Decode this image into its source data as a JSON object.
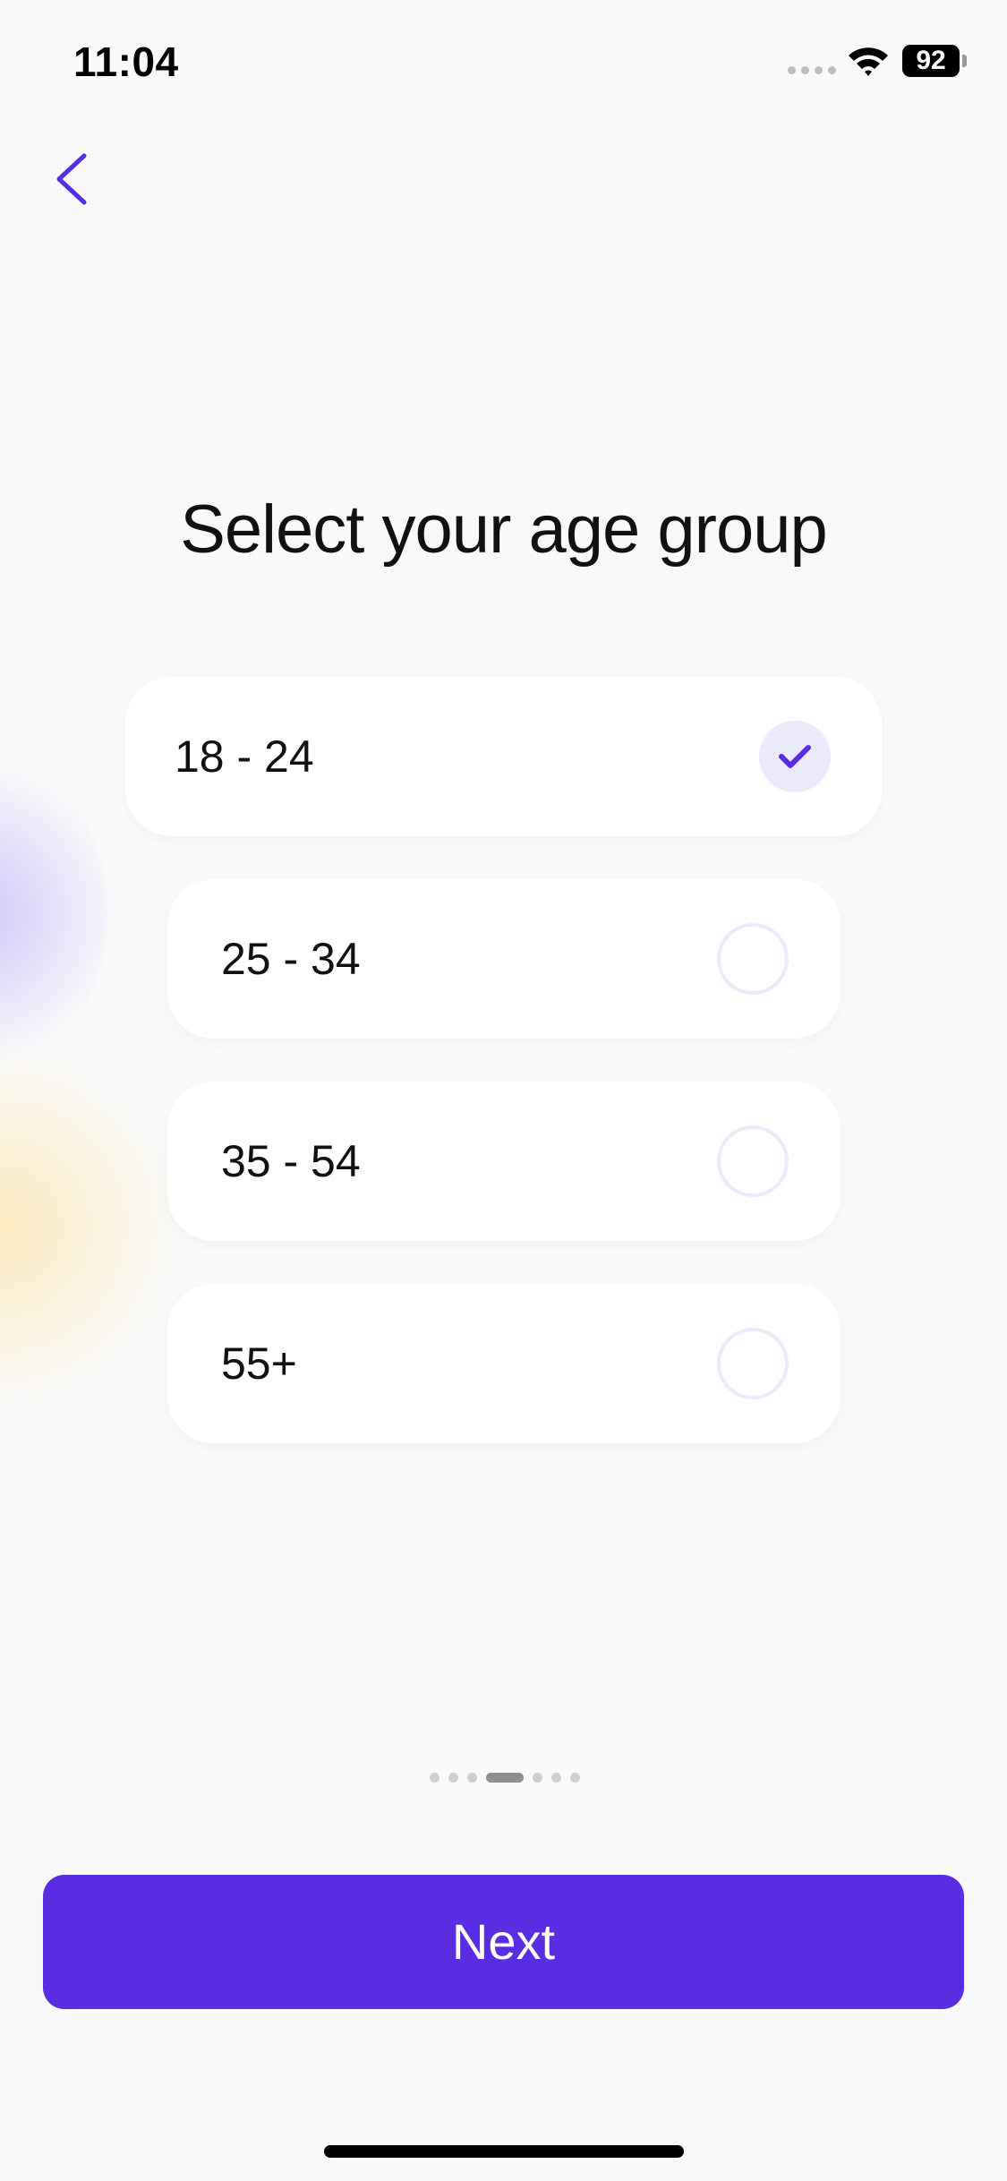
{
  "status_bar": {
    "time": "11:04",
    "battery": "92"
  },
  "page": {
    "title": "Select your age group"
  },
  "options": [
    {
      "label": "18 - 24",
      "selected": true
    },
    {
      "label": "25 - 34",
      "selected": false
    },
    {
      "label": "35 - 54",
      "selected": false
    },
    {
      "label": "55+",
      "selected": false
    }
  ],
  "pagination": {
    "total": 7,
    "current": 4
  },
  "footer": {
    "next_label": "Next"
  },
  "colors": {
    "accent": "#5b2de2",
    "radio_border": "#ecebfb",
    "background": "#f9f9f9"
  }
}
